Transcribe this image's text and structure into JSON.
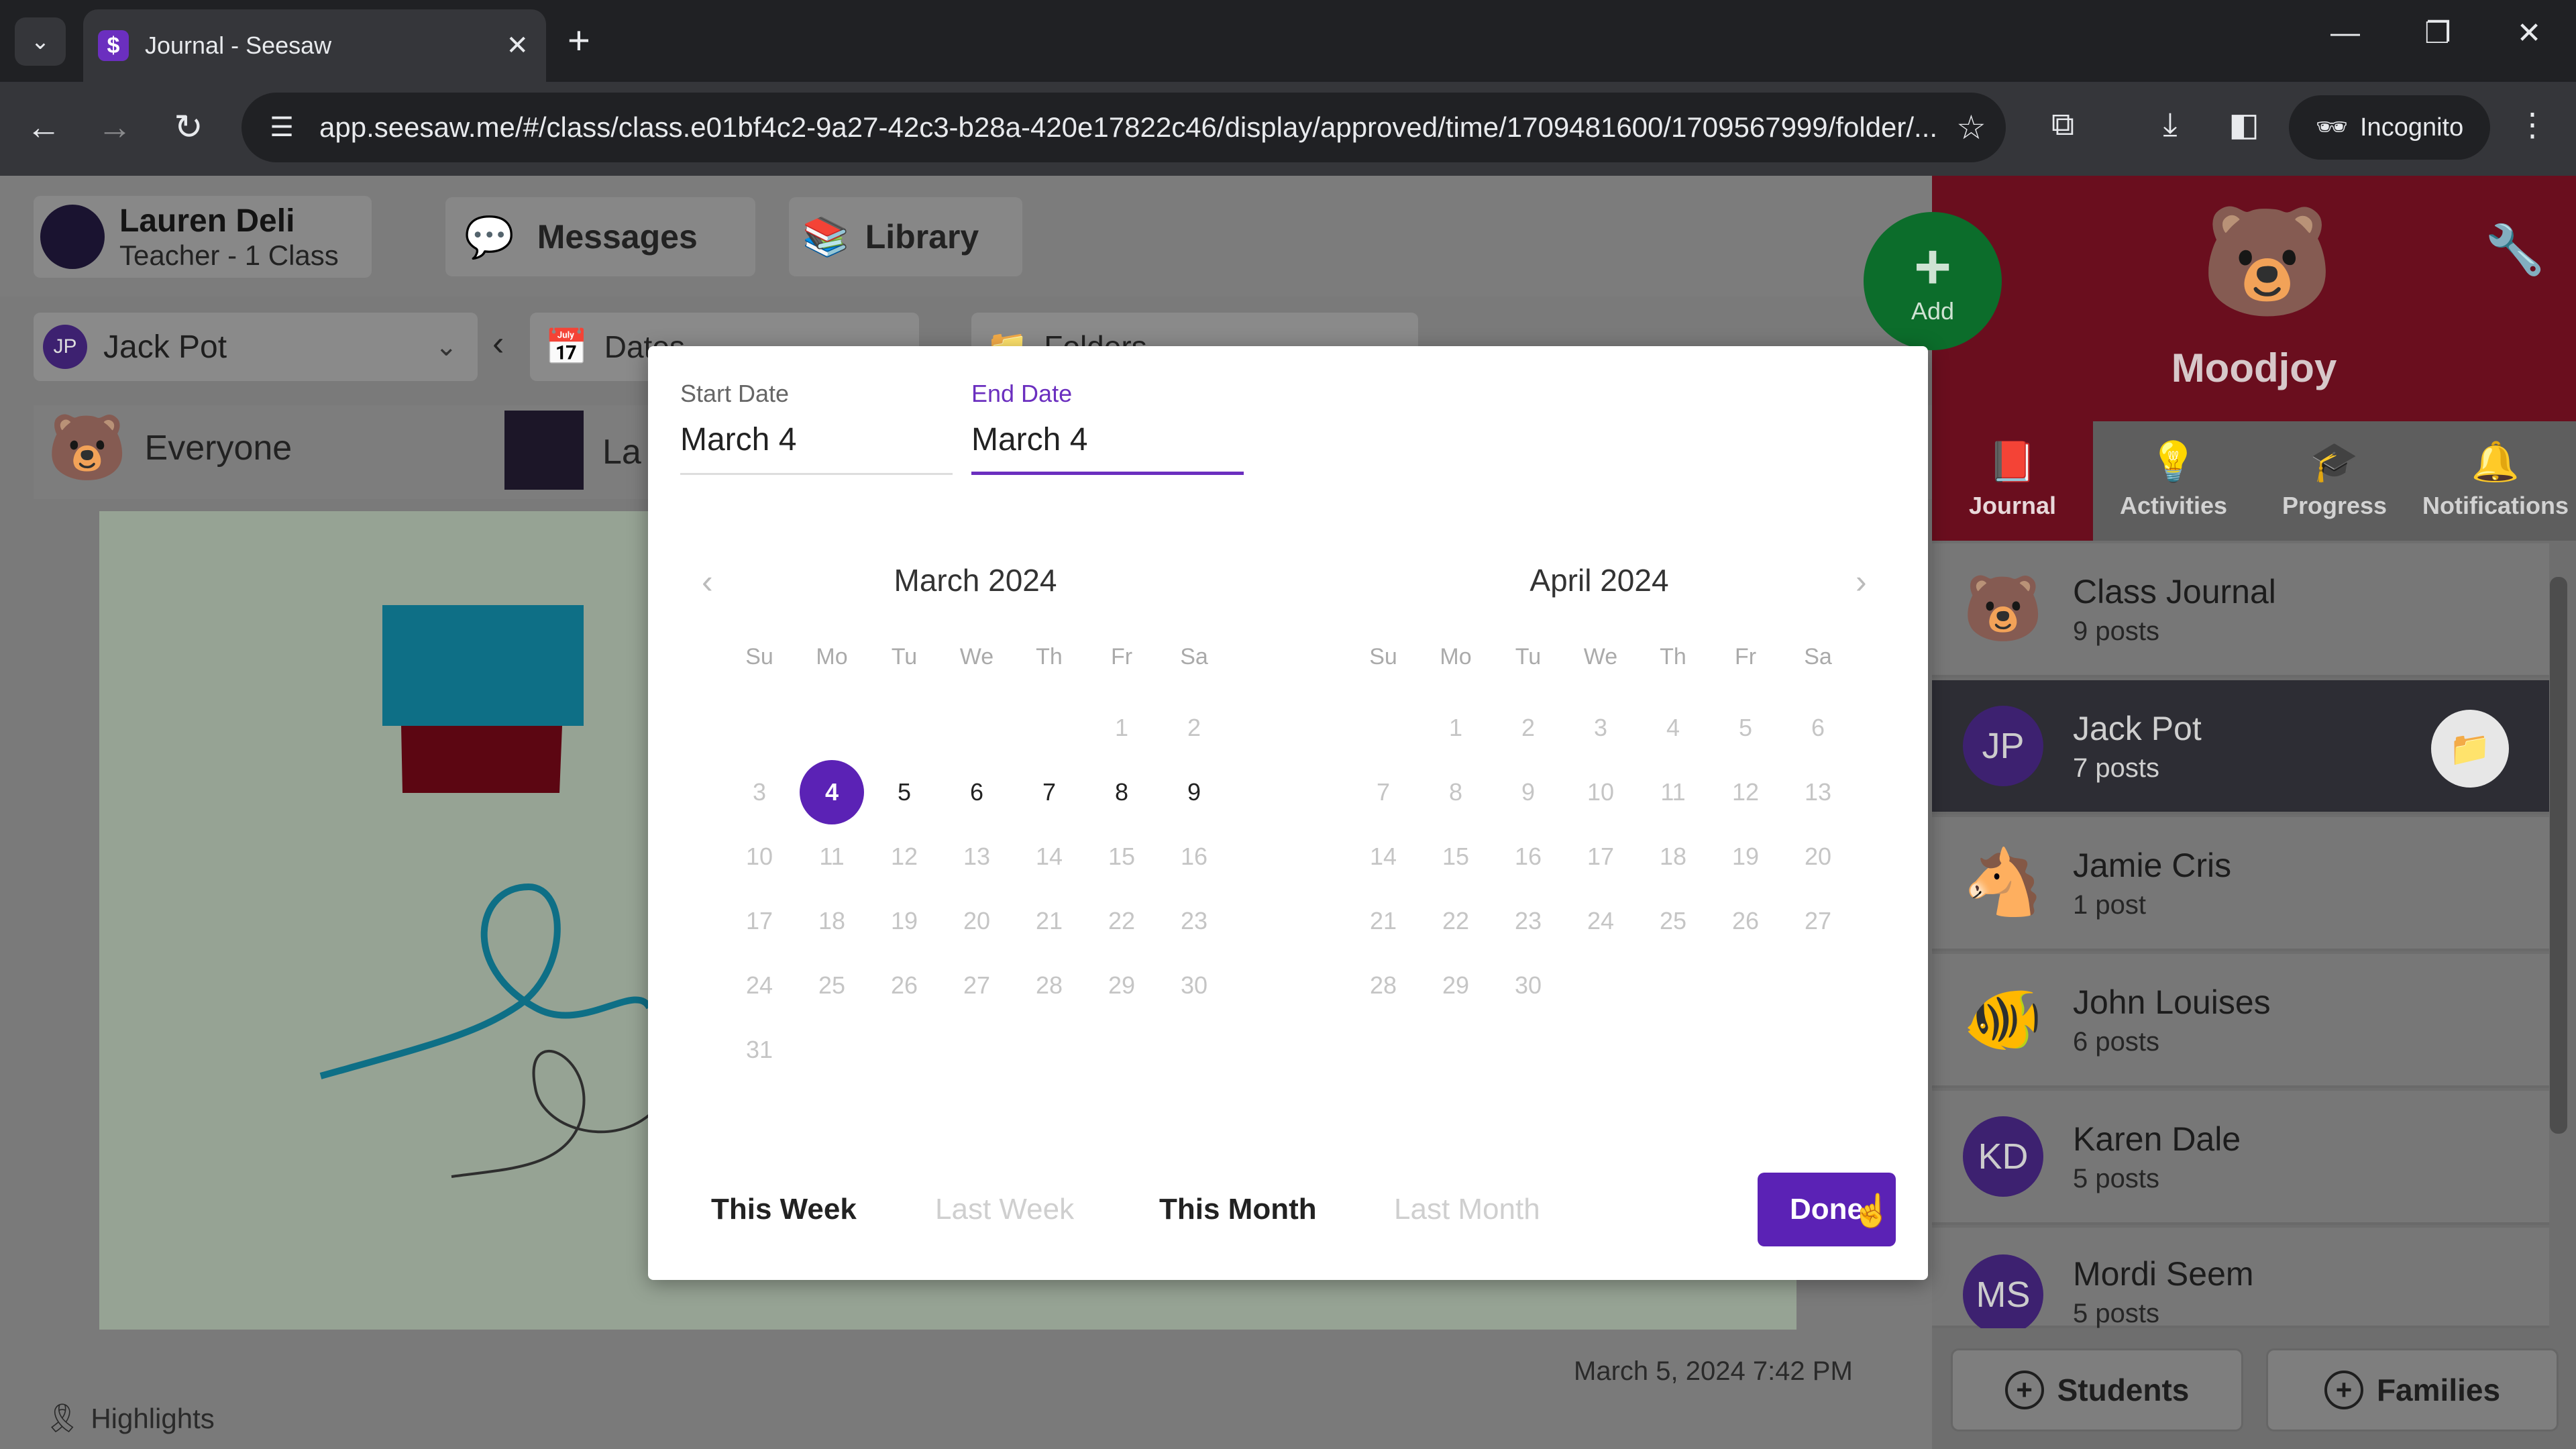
{
  "browser": {
    "tab_title": "Journal - Seesaw",
    "tab_favicon": "$",
    "url": "app.seesaw.me/#/class/class.e01bf4c2-9a27-42c3-b28a-420e17822c46/display/approved/time/1709481600/1709567999/folder/...",
    "incognito_label": "Incognito"
  },
  "topbar": {
    "user_name": "Lauren Deli",
    "user_role": "Teacher - 1 Class",
    "messages_label": "Messages",
    "library_label": "Library"
  },
  "filters": {
    "student_initials": "JP",
    "student_name": "Jack Pot",
    "dates_label": "Dates",
    "folders_label": "Folders"
  },
  "people_row": {
    "everyone_label": "Everyone",
    "partial_label": "La"
  },
  "post": {
    "timestamp": "March 5, 2024 7:42 PM"
  },
  "highlights_label": "Highlights",
  "sidebar": {
    "class_name": "Moodjoy",
    "add_label": "Add",
    "nav": [
      {
        "label": "Journal",
        "icon": "book-icon"
      },
      {
        "label": "Activities",
        "icon": "lightbulb-icon"
      },
      {
        "label": "Progress",
        "icon": "graduation-cap-icon"
      },
      {
        "label": "Notifications",
        "icon": "bell-icon"
      }
    ],
    "students": [
      {
        "name": "Class Journal",
        "count": "9 posts",
        "avatar": "🌈"
      },
      {
        "name": "Jack Pot",
        "count": "7 posts",
        "avatar": "JP",
        "selected": true
      },
      {
        "name": "Jamie Cris",
        "count": "1 post",
        "avatar": "🐴"
      },
      {
        "name": "John Louises",
        "count": "6 posts",
        "avatar": "🐠"
      },
      {
        "name": "Karen Dale",
        "count": "5 posts",
        "avatar": "KD"
      },
      {
        "name": "Mordi Seem",
        "count": "5 posts",
        "avatar": "MS"
      }
    ],
    "students_btn": "Students",
    "families_btn": "Families"
  },
  "datepicker": {
    "start_label": "Start Date",
    "start_value": "March 4",
    "end_label": "End Date",
    "end_value": "March 4",
    "months": [
      {
        "title": "March 2024",
        "first_dow": 5,
        "days": 31,
        "active": [
          4,
          5,
          6,
          7,
          8,
          9
        ],
        "selected": 4
      },
      {
        "title": "April 2024",
        "first_dow": 1,
        "days": 30,
        "active": [],
        "selected": null
      }
    ],
    "weekdays": [
      "Su",
      "Mo",
      "Tu",
      "We",
      "Th",
      "Fr",
      "Sa"
    ],
    "presets": {
      "this_week": "This Week",
      "last_week": "Last Week",
      "this_month": "This Month",
      "last_month": "Last Month"
    },
    "done_label": "Done"
  }
}
